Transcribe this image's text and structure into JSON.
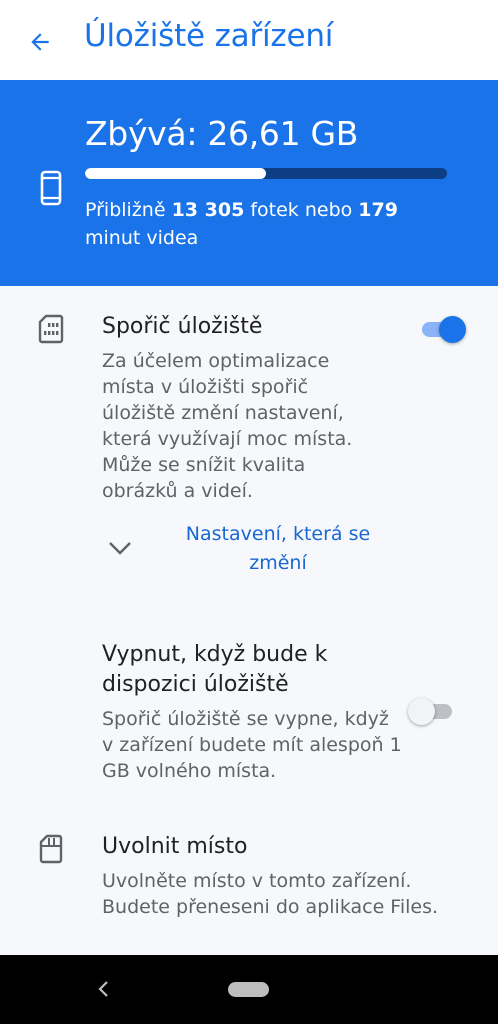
{
  "appbar": {
    "title": "Úložiště zařízení",
    "back_icon": "arrow-back-icon",
    "accent": "#1a73e8"
  },
  "summary": {
    "remaining": "Zbývá: 26,61 GB",
    "used_fraction": 0.5,
    "estimate_prefix": "Přibližně ",
    "photos": "13 305",
    "photos_unit": " fotek nebo ",
    "minutes": "179",
    "minutes_unit": " minut videa",
    "icon": "phone-icon",
    "background": "#1a73e8"
  },
  "storage_saver": {
    "title": "Spořič úložiště",
    "description": "Za účelem optimalizace místa v úložišti spořič úložiště změní nastavení, která využívají moc místa. Může se snížit kvalita obrázků a videí.",
    "enabled": true,
    "icon": "sd-card-icon",
    "expand_label": "Nastavení, která se změní",
    "expand_icon": "chevron-down-icon"
  },
  "auto_off": {
    "title": "Vypnut, když bude k dispozici úložiště",
    "description": "Spořič úložiště se vypne, když v zařízení budete mít alespoň 1 GB volného místa.",
    "enabled": false
  },
  "free_up": {
    "title": "Uvolnit místo",
    "description": "Uvolněte místo v tomto zařízení. Budete přeneseni do aplikace Files.",
    "icon": "sd-card-outline-icon"
  },
  "navbar": {
    "back_icon": "nav-back-icon",
    "home_icon": "home-pill-icon"
  }
}
